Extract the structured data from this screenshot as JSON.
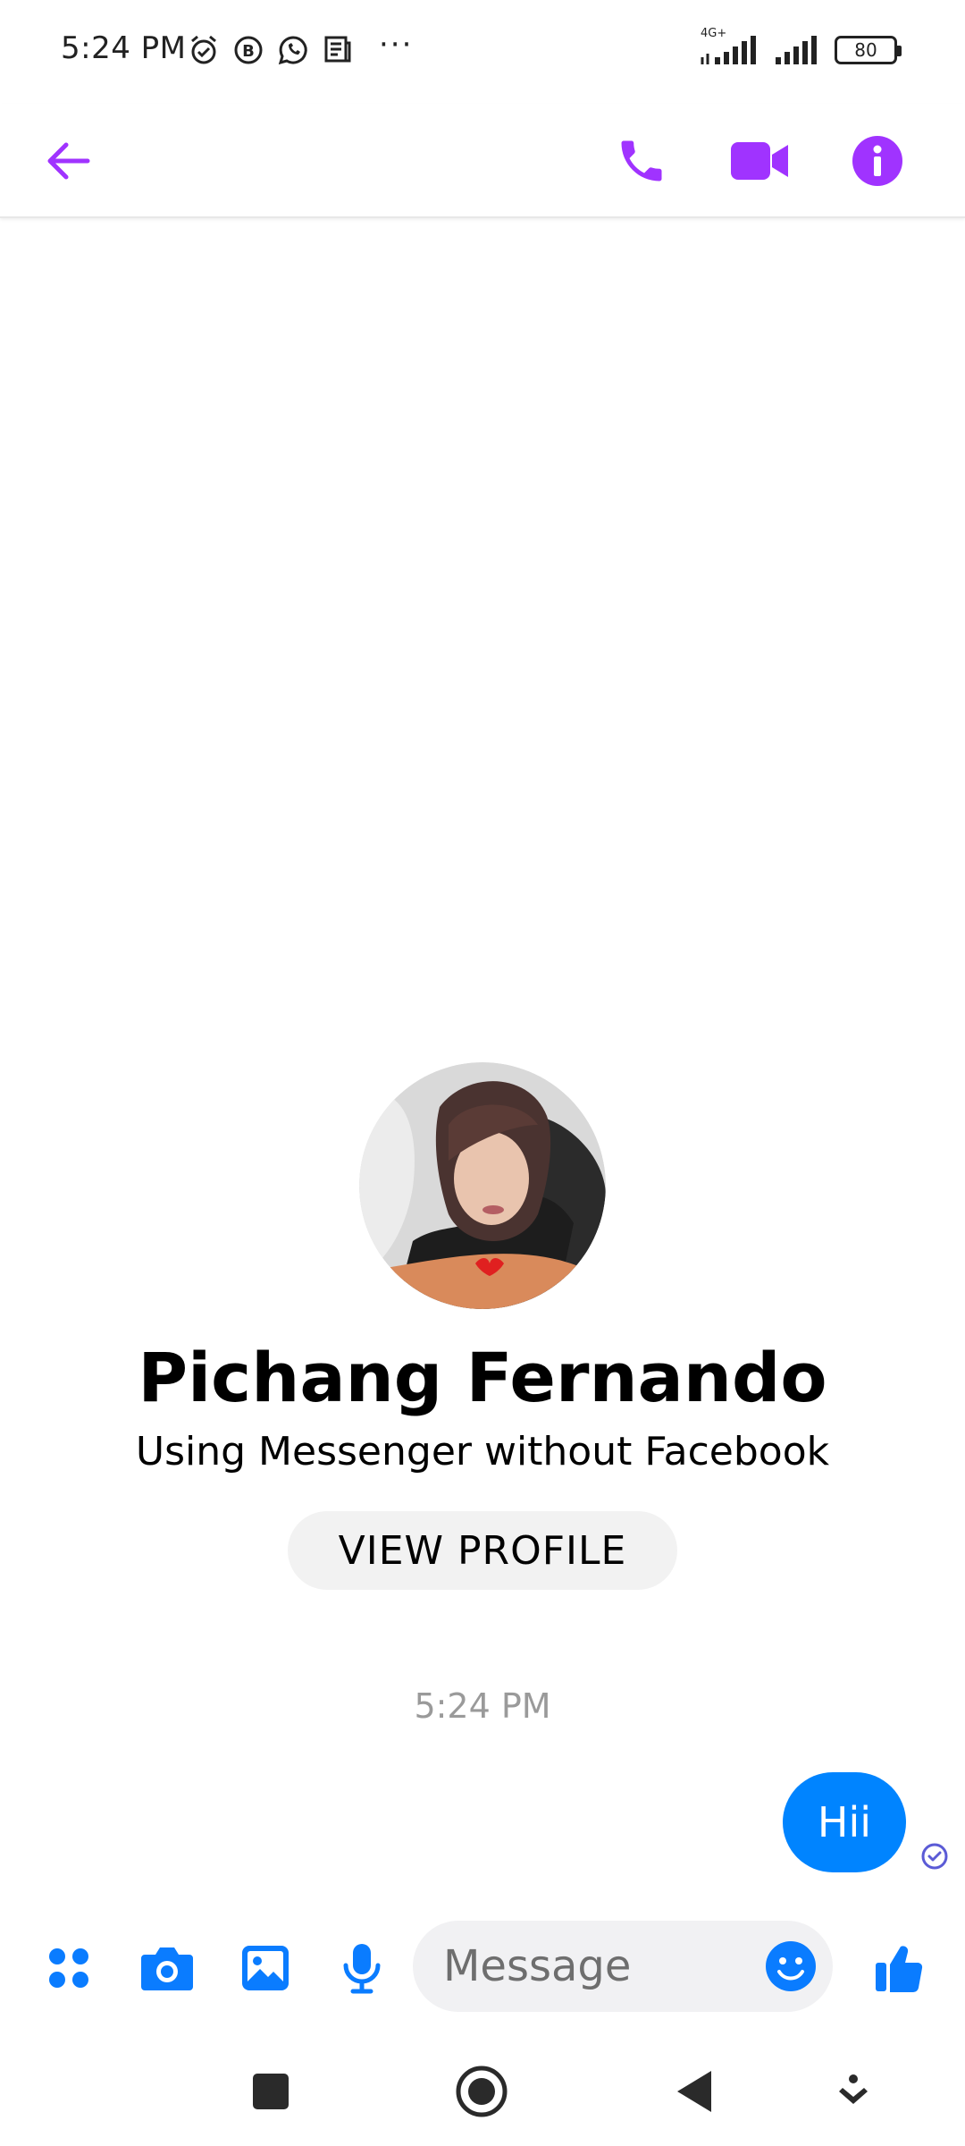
{
  "status_bar": {
    "time": "5:24 PM",
    "network": "4G+",
    "battery": "80",
    "overflow": "···",
    "icons": [
      "alarm-icon",
      "b-circle-icon",
      "whatsapp-icon",
      "news-icon",
      "signal-icon",
      "signal-icon",
      "battery-icon"
    ]
  },
  "header": {
    "icons": [
      "back-arrow-icon",
      "phone-icon",
      "video-icon",
      "info-icon"
    ],
    "accent_color": "#a033ff"
  },
  "profile": {
    "name": "Pichang Fernando",
    "subtitle": "Using Messenger without Facebook",
    "view_profile_label": "VIEW PROFILE"
  },
  "conversation": {
    "timestamp": "5:24 PM",
    "messages": [
      {
        "from": "me",
        "text": "Hii"
      }
    ],
    "bubble_color": "#0084ff"
  },
  "composer": {
    "placeholder": "Message",
    "icons": [
      "apps-icon",
      "camera-icon",
      "gallery-icon",
      "mic-icon",
      "emoji-icon",
      "thumbs-up-icon"
    ],
    "icon_color": "#0a7cff"
  },
  "nav_bar": {
    "icons": [
      "square-icon",
      "home-circle-icon",
      "back-triangle-icon",
      "menu-down-icon"
    ]
  }
}
